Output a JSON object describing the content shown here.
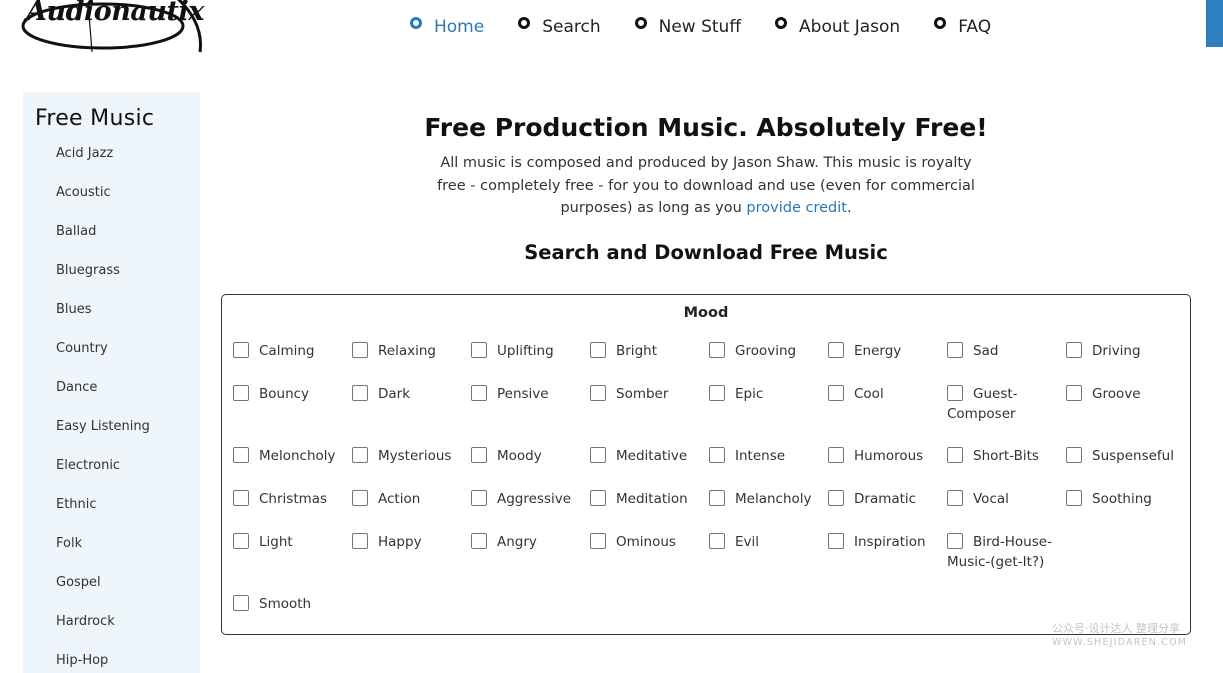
{
  "logo": {
    "text": "Audionautix"
  },
  "nav": [
    {
      "label": "Home",
      "active": true
    },
    {
      "label": "Search",
      "active": false
    },
    {
      "label": "New Stuff",
      "active": false
    },
    {
      "label": "About Jason",
      "active": false
    },
    {
      "label": "FAQ",
      "active": false
    }
  ],
  "sidebar": {
    "title": "Free Music",
    "items": [
      "Acid Jazz",
      "Acoustic",
      "Ballad",
      "Bluegrass",
      "Blues",
      "Country",
      "Dance",
      "Easy Listening",
      "Electronic",
      "Ethnic",
      "Folk",
      "Gospel",
      "Hardrock",
      "Hip-Hop"
    ]
  },
  "main": {
    "title": "Free Production Music. Absolutely Free!",
    "intro_text": "All music is composed and produced by Jason Shaw. This music is royalty free - completely free - for you to download and use (even for commercial purposes) as long as you ",
    "intro_link": "provide credit",
    "intro_end": ".",
    "section_title": "Search and Download Free Music"
  },
  "mood": {
    "title": "Mood",
    "options": [
      "Calming",
      "Relaxing",
      "Uplifting",
      "Bright",
      "Grooving",
      "Energy",
      "Sad",
      "Driving",
      "Bouncy",
      "Dark",
      "Pensive",
      "Somber",
      "Epic",
      "Cool",
      "Guest-Composer",
      "Groove",
      "Meloncholy",
      "Mysterious",
      "Moody",
      "Meditative",
      "Intense",
      "Humorous",
      "Short-Bits",
      "Suspenseful",
      "Christmas",
      "Action",
      "Aggressive",
      "Meditation",
      "Melancholy",
      "Dramatic",
      "Vocal",
      "Soothing",
      "Light",
      "Happy",
      "Angry",
      "Ominous",
      "Evil",
      "Inspiration",
      "Bird-House-Music-(get-It?)",
      "Smooth"
    ]
  },
  "watermark": {
    "line1": "公众号·设计达人 整理分享",
    "line2": "WWW.SHEJIDAREN.COM"
  },
  "colors": {
    "accent": "#2d78b3",
    "sidebar_bg": "#eef5fb",
    "corner_tab": "#2d7fc0"
  }
}
